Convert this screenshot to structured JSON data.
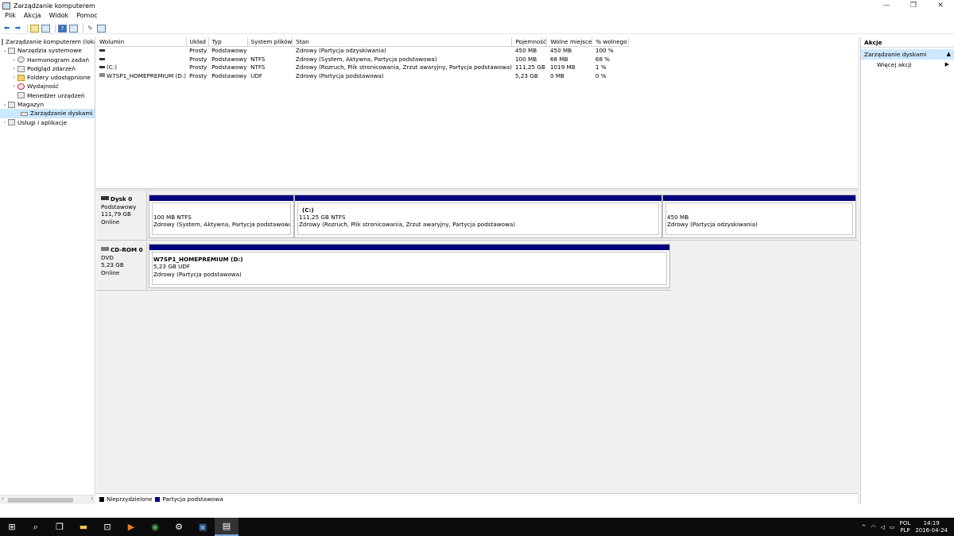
{
  "window": {
    "title": "Zarządzanie komputerem",
    "minimize": "—",
    "restore": "❐",
    "close": "✕"
  },
  "menu": [
    "Plik",
    "Akcja",
    "Widok",
    "Pomoc"
  ],
  "tree": {
    "root": "Zarządzanie komputerem (loka",
    "system_tools": "Narzędzia systemowe",
    "scheduler": "Harmonogram zadań",
    "events": "Podgląd zdarzeń",
    "shared": "Foldery udostępnione",
    "performance": "Wydajność",
    "device_manager": "Menedżer urządzeń",
    "storage": "Magazyn",
    "disk_mgmt": "Zarządzanie dyskami",
    "services": "Usługi i aplikacje"
  },
  "volumes": {
    "columns": [
      "Wolumin",
      "Układ",
      "Typ",
      "System plików",
      "Stan",
      "Pojemność",
      "Wolne miejsce",
      "% wolnego"
    ],
    "rows": [
      [
        "",
        "Prosty",
        "Podstawowy",
        "",
        "Zdrowy (Partycja odzyskiwania)",
        "450 MB",
        "450 MB",
        "100 %"
      ],
      [
        "",
        "Prosty",
        "Podstawowy",
        "NTFS",
        "Zdrowy (System, Aktywna, Partycja podstawowa)",
        "100 MB",
        "68 MB",
        "68 %"
      ],
      [
        "(C:)",
        "Prosty",
        "Podstawowy",
        "NTFS",
        "Zdrowy (Rozruch, Plik stronicowania, Zrzut awaryjny, Partycja podstawowa)",
        "111,25 GB",
        "1019 MB",
        "1 %"
      ],
      [
        "W7SP1_HOMEPREMIUM (D:)",
        "Prosty",
        "Podstawowy",
        "UDF",
        "Zdrowy (Partycja podstawowa)",
        "5,23 GB",
        "0 MB",
        "0 %"
      ]
    ]
  },
  "disk0": {
    "name": "Dysk 0",
    "type": "Podstawowy",
    "size": "111,79 GB",
    "status": "Online",
    "p1": {
      "title": "",
      "size": "100 MB NTFS",
      "status": "Zdrowy (System, Aktywna, Partycja podstawowa)"
    },
    "p2": {
      "title": "(C:)",
      "size": "111,25 GB NTFS",
      "status": "Zdrowy (Rozruch, Plik stronicowania, Zrzut awaryjny, Partycja podstawowa)"
    },
    "p3": {
      "title": "",
      "size": "450 MB",
      "status": "Zdrowy (Partycja odzyskiwania)"
    }
  },
  "cdrom0": {
    "name": "CD-ROM 0",
    "type": "DVD",
    "size": "5,23 GB",
    "status": "Online",
    "p1": {
      "title": "W7SP1_HOMEPREMIUM  (D:)",
      "size": "5,23 GB UDF",
      "status": "Zdrowy (Partycja podstawowa)"
    }
  },
  "legend": {
    "unallocated": "Nieprzydzielone",
    "primary": "Partycja podstawowa"
  },
  "actions": {
    "header": "Akcje",
    "selected": "Zarządzanie dyskami",
    "more": "Więcej akcji"
  },
  "tray": {
    "lang1": "POL",
    "lang2": "PLP",
    "time": "14:19",
    "date": "2016-04-24"
  },
  "colors": {
    "primary_partition": "#00007f",
    "unallocated": "#000000",
    "selection": "#cde8ff"
  }
}
